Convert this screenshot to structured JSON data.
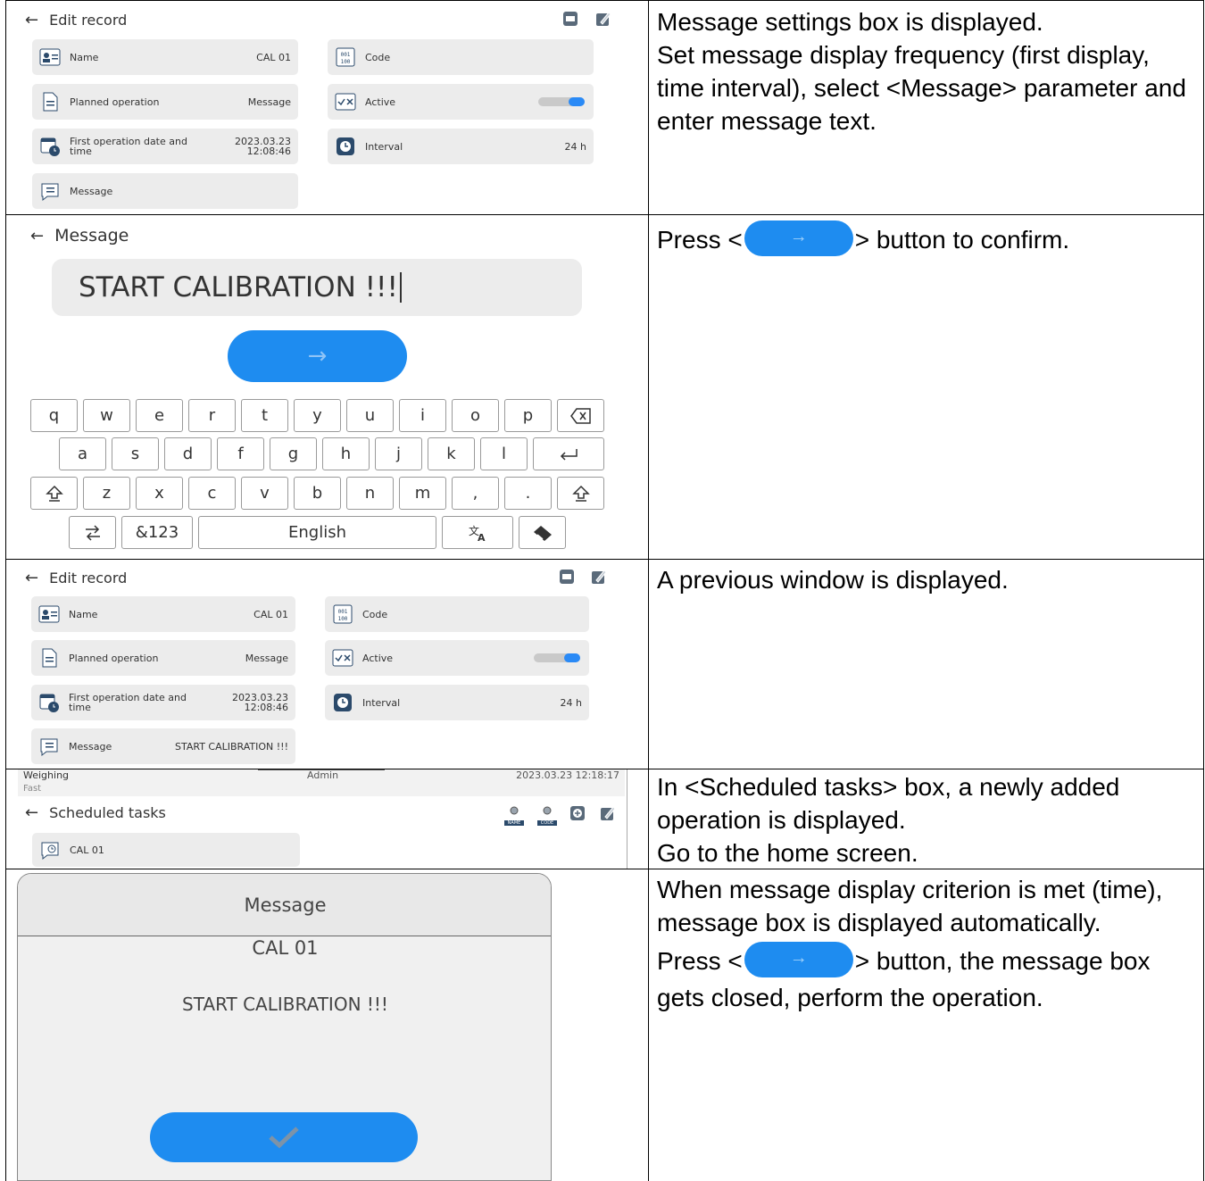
{
  "rows": [
    {
      "instructions": [
        "Message settings box is displayed.",
        "Set message display frequency (first display, time interval), select <Message> parameter and enter message text."
      ],
      "screen": {
        "header": "Edit record",
        "fields": [
          {
            "label": "Name",
            "value": "CAL 01"
          },
          {
            "label": "Code",
            "value": ""
          },
          {
            "label": "Planned operation",
            "value": "Message"
          },
          {
            "label": "Active",
            "value": ""
          },
          {
            "label_line1": "First operation date and",
            "label_line2": "time",
            "value_line1": "2023.03.23",
            "value_line2": "12:08:46"
          },
          {
            "label": "Interval",
            "value": "24 h"
          },
          {
            "label": "Message",
            "value": ""
          }
        ]
      }
    },
    {
      "instruction_prefix": "Press <",
      "instruction_suffix": "> button to confirm.",
      "screen": {
        "header": "Message",
        "input_value": "START CALIBRATION !!!",
        "keyboard": {
          "row1": [
            "q",
            "w",
            "e",
            "r",
            "t",
            "y",
            "u",
            "i",
            "o",
            "p"
          ],
          "row2": [
            "a",
            "s",
            "d",
            "f",
            "g",
            "h",
            "j",
            "k",
            "l"
          ],
          "row3": [
            "z",
            "x",
            "c",
            "v",
            "b",
            "n",
            "m",
            ",",
            "."
          ],
          "numbers_key": "&123",
          "space_key": "English"
        }
      }
    },
    {
      "instructions": [
        "A previous window is displayed."
      ],
      "screen": {
        "header": "Edit record",
        "fields": [
          {
            "label": "Name",
            "value": "CAL 01"
          },
          {
            "label": "Code",
            "value": ""
          },
          {
            "label": "Planned operation",
            "value": "Message"
          },
          {
            "label": "Active",
            "value": ""
          },
          {
            "label_line1": "First operation date and",
            "label_line2": "time",
            "value_line1": "2023.03.23",
            "value_line2": "12:08:46"
          },
          {
            "label": "Interval",
            "value": "24 h"
          },
          {
            "label": "Message",
            "value": "START CALIBRATION !!!"
          }
        ]
      }
    },
    {
      "instructions": [
        "In <Scheduled tasks> box, a newly added operation is displayed.",
        "Go to the home screen."
      ],
      "screen": {
        "status_mode": "Weighing",
        "status_sub": "Fast",
        "status_user": "Admin",
        "status_datetime": "2023.03.23 12:18:17",
        "header": "Scheduled tasks",
        "item": "CAL 01",
        "icon_name_label": "NAME",
        "icon_code_label": "CODE"
      }
    },
    {
      "instructions": [
        "When message display criterion is met (time), message box is displayed automatically."
      ],
      "instruction2_prefix": "Press <",
      "instruction2_suffix": "> button, the message box gets closed, perform the operation.",
      "screen": {
        "title": "Message",
        "name": "CAL 01",
        "text": "START CALIBRATION !!!"
      }
    }
  ],
  "colors": {
    "accent": "#1e8cf0",
    "field_bg": "#ececec",
    "toggle_on": "#2a8af6"
  }
}
